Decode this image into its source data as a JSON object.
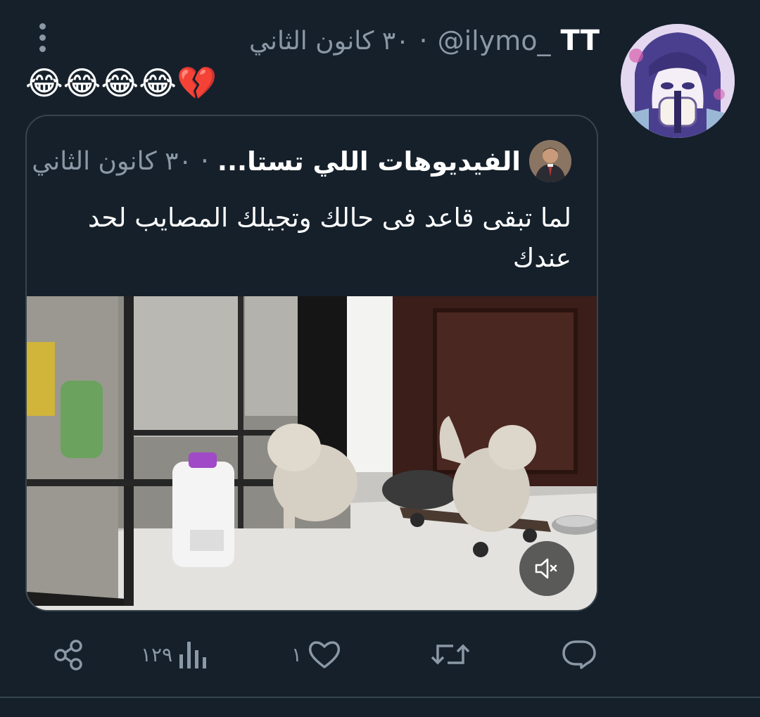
{
  "tweet": {
    "display_name": "TT",
    "handle": "@ilymo_",
    "separator": "·",
    "date": "٣٠ كانون الثاني",
    "emoji_text": "😂😂😂😂💔"
  },
  "quoted": {
    "display_name": "الفيديوهات اللي تستا...",
    "separator": "·",
    "date": "٣٠ كانون الثاني",
    "text": "لما تبقى قاعد فى حالك وتجيلك المصايب لحد عندك"
  },
  "actions": {
    "reply_count": "",
    "retweet_count": "",
    "like_count": "١",
    "views_count": "١٢٩"
  },
  "icons": {
    "more": "more-vertical-icon",
    "mute": "volume-muted-icon",
    "reply": "reply-icon",
    "retweet": "retweet-icon",
    "like": "heart-icon",
    "views": "views-bar-chart-icon",
    "share": "share-icon"
  },
  "colors": {
    "background": "#15202b",
    "secondary_text": "#8b98a5",
    "border": "#38444d"
  }
}
